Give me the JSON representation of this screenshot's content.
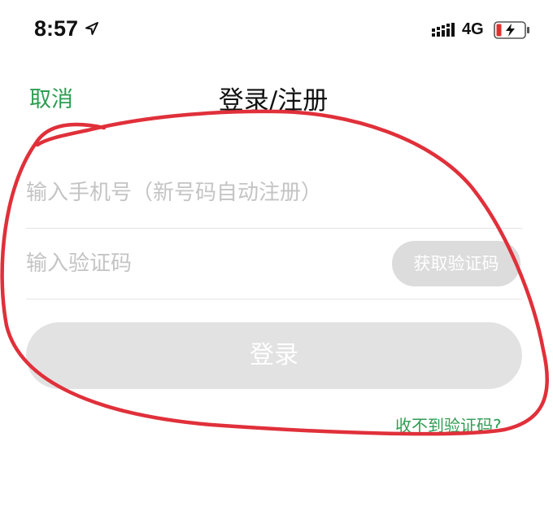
{
  "status_bar": {
    "time": "8:57",
    "network": "4G",
    "icons": [
      "location-arrow-icon",
      "signal-icon",
      "battery-charging-icon"
    ],
    "battery_color": "#e0302e"
  },
  "nav": {
    "cancel_label": "取消",
    "title": "登录/注册"
  },
  "form": {
    "phone_placeholder": "输入手机号（新号码自动注册）",
    "phone_value": "",
    "code_placeholder": "输入验证码",
    "code_value": "",
    "get_code_label": "获取验证码",
    "login_label": "登录",
    "no_code_link": "收不到验证码?"
  },
  "colors": {
    "accent": "#2e9d52",
    "disabled_button": "#e2e2e2",
    "annotation": "#e0303a"
  }
}
